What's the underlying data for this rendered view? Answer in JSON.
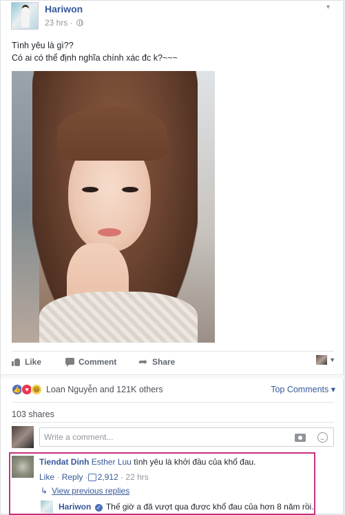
{
  "post": {
    "author": "Hariwon",
    "time": "23 hrs",
    "text_line1": "Tình yêu là gì??",
    "text_line2": "Có ai có thể định nghĩa chính xác đc k?~~~"
  },
  "actions": {
    "like": "Like",
    "comment": "Comment",
    "share": "Share"
  },
  "reactions": {
    "summary": "Loan Nguyễn and 121K others",
    "top_comments": "Top Comments"
  },
  "shares": "103 shares",
  "composer": {
    "placeholder": "Write a comment..."
  },
  "comments": [
    {
      "author": "Tiendat Dinh",
      "tag": "Esther Luu",
      "text": "tình yêu là khởi đầu của khổ đau.",
      "like": "Like",
      "reply": "Reply",
      "likes_count": "2,912",
      "time": "22 hrs"
    }
  ],
  "view_previous": "View previous replies",
  "reply": {
    "author": "Hariwon",
    "text": "Thế giờ a đã vượt qua được khổ đau của hơn 8 năm rồi."
  }
}
